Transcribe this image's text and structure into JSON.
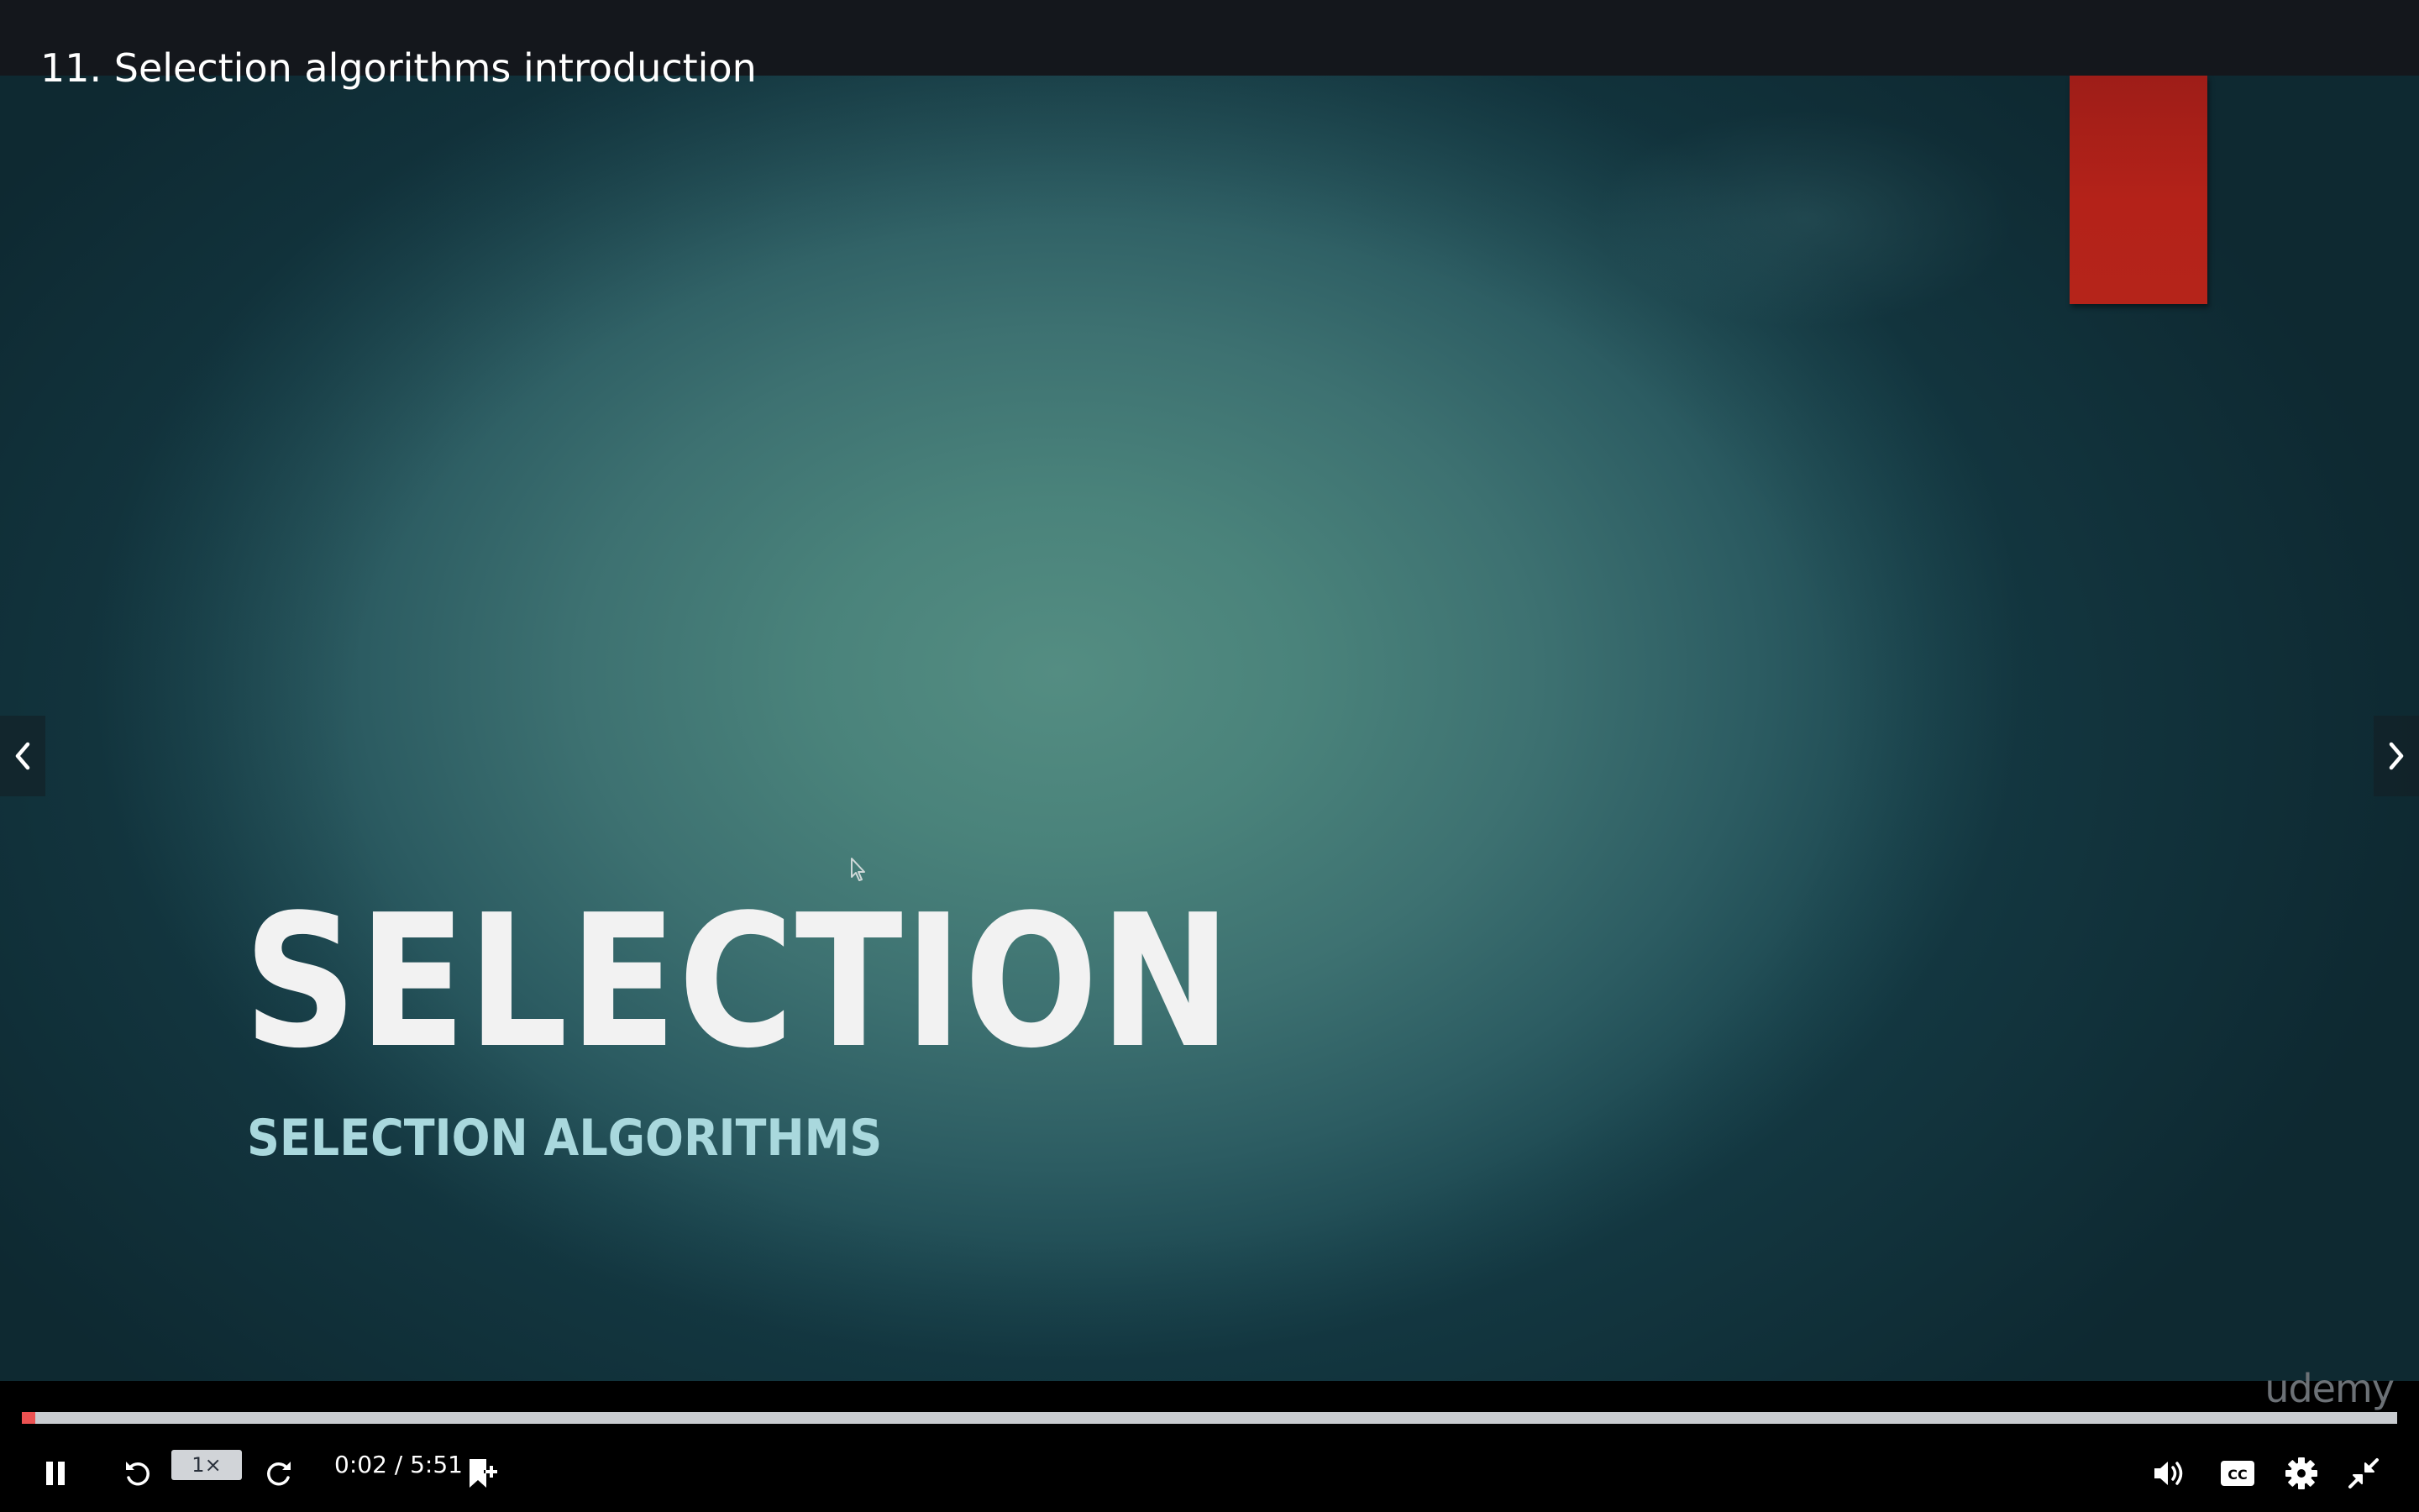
{
  "header": {
    "lecture_title": "11. Selection algorithms introduction"
  },
  "slide": {
    "title": "SELECTION",
    "subtitle": "SELECTION ALGORITHMS",
    "accent_color": "#b42219"
  },
  "player": {
    "watermark": "udemy",
    "playback_rate": "1×",
    "current_time": "0:02",
    "duration": "5:51",
    "time_display": "0:02 / 5:51",
    "progress_fraction": 0.0057,
    "progress_color": "#ec5252",
    "state": "playing"
  },
  "controls": {
    "icons": [
      "pause-icon",
      "rewind-icon",
      "forward-icon",
      "add-bookmark-icon",
      "volume-icon",
      "captions-icon",
      "settings-icon",
      "exit-fullscreen-icon"
    ],
    "captions_label": "CC"
  },
  "navigation": {
    "prev_icon": "chevron-left-icon",
    "next_icon": "chevron-right-icon"
  }
}
